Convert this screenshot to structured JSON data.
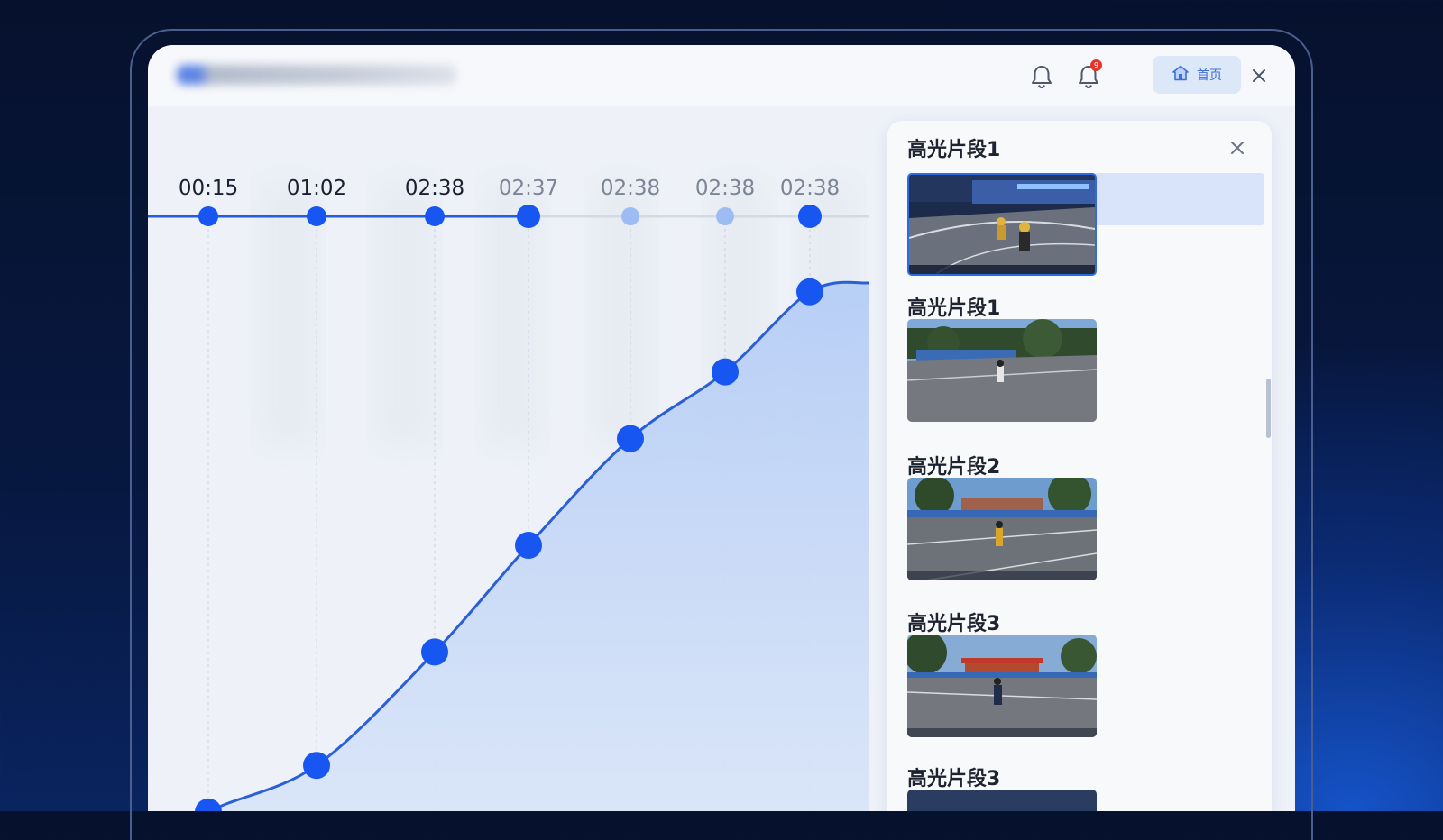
{
  "header": {
    "app_title": "",
    "bell_badge": "9",
    "home_label": "首页"
  },
  "icons": {
    "bell": "bell-icon",
    "bell_alert": "bell-alert-icon",
    "home": "home-icon",
    "close": "close-icon"
  },
  "colors": {
    "accent": "#1756f0",
    "accent_light": "#9dbcf4",
    "line": "#2a5fd6",
    "fill": "#c9dbf8"
  },
  "timeline": {
    "markers": [
      {
        "time": "00:15",
        "state": "active"
      },
      {
        "time": "01:02",
        "state": "active"
      },
      {
        "time": "02:38",
        "state": "active"
      },
      {
        "time": "02:37",
        "state": "current"
      },
      {
        "time": "02:38",
        "state": "inactive"
      },
      {
        "time": "02:38",
        "state": "inactive"
      },
      {
        "time": "02:38",
        "state": "active"
      }
    ]
  },
  "chart_data": {
    "type": "area",
    "x": [
      "00:15",
      "01:02",
      "02:38",
      "02:37",
      "02:38",
      "02:38",
      "02:38"
    ],
    "values": [
      5,
      12,
      29,
      45,
      61,
      71,
      83
    ],
    "ylim": [
      0,
      100
    ],
    "grid": "vertical",
    "title": "",
    "xlabel": "",
    "ylabel": ""
  },
  "panel": {
    "title": "高光片段1",
    "clips": [
      {
        "label": "",
        "selected": true,
        "scene": "stadium-night"
      },
      {
        "label": "高光片段1",
        "selected": false,
        "scene": "park-day"
      },
      {
        "label": "高光片段2",
        "selected": false,
        "scene": "track-trees"
      },
      {
        "label": "高光片段3",
        "selected": false,
        "scene": "track-gate"
      },
      {
        "label": "高光片段3",
        "selected": false,
        "scene": "track-partial"
      }
    ]
  }
}
